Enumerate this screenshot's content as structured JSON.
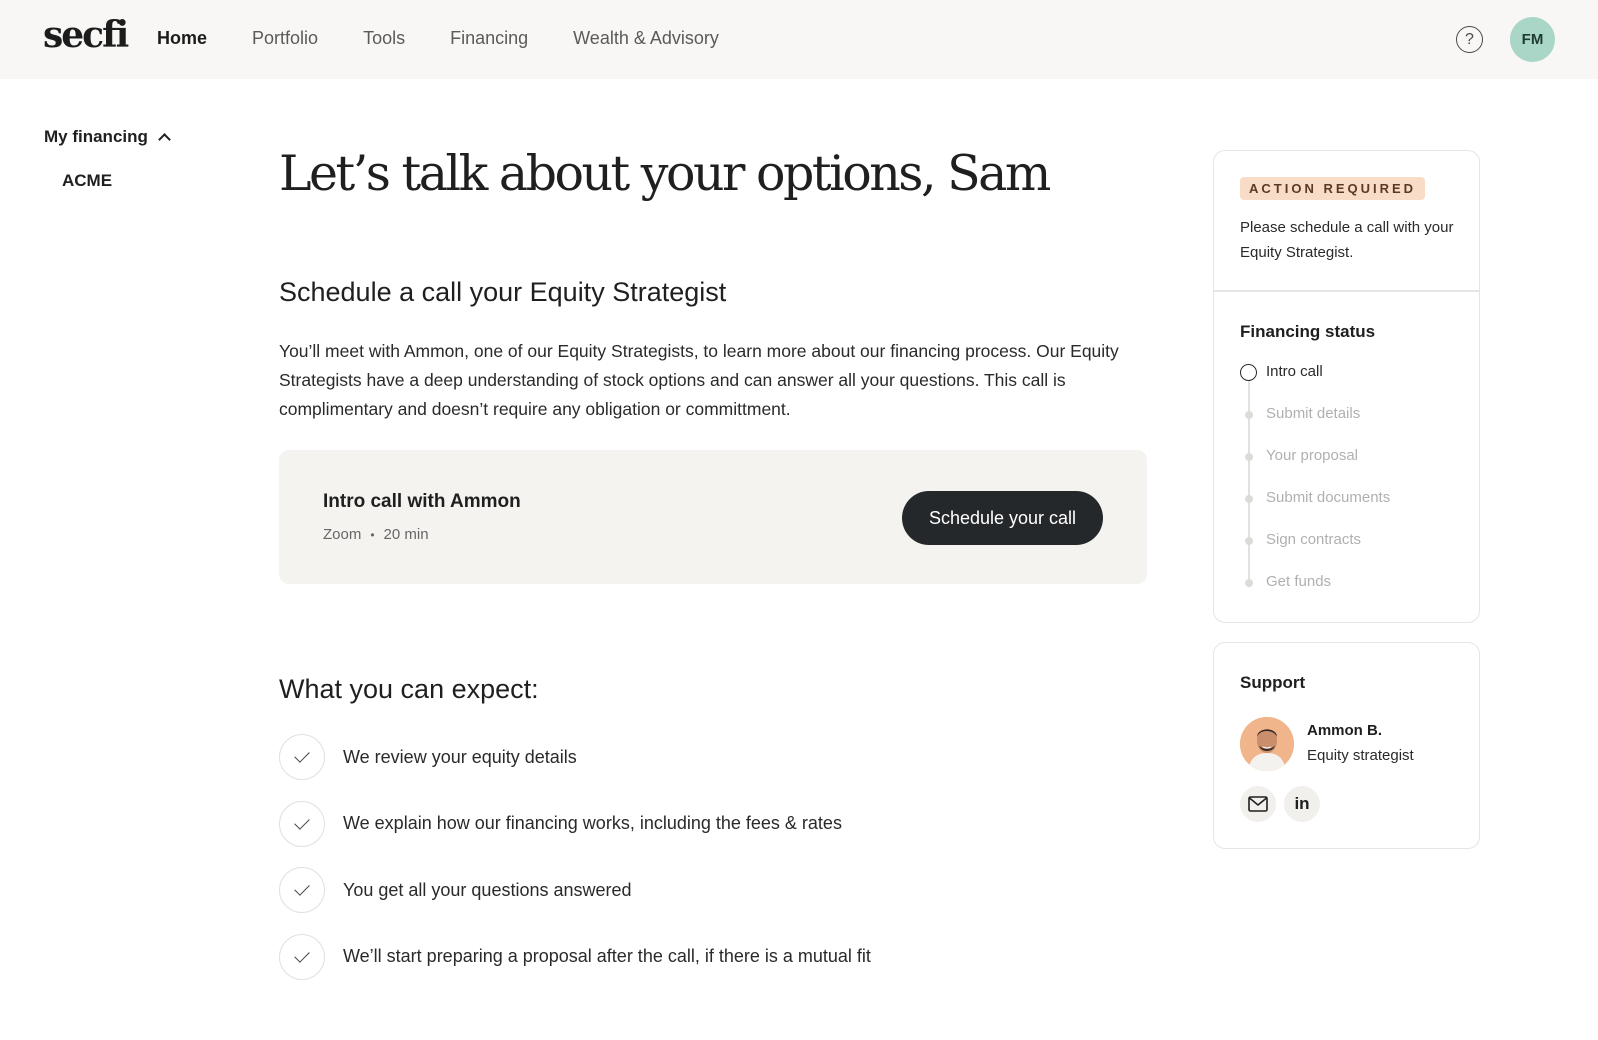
{
  "header": {
    "logo": "secfi",
    "nav": [
      "Home",
      "Portfolio",
      "Tools",
      "Financing",
      "Wealth & Advisory"
    ],
    "help_icon": "question-circle-icon",
    "avatar_initials": "FM",
    "avatar_color": "#a9d6c6"
  },
  "sidebar": {
    "section_label": "My financing",
    "toggle_icon": "chevron-up-icon",
    "items": [
      "ACME"
    ]
  },
  "main": {
    "title": "Let’s talk about your options, Sam",
    "schedule_heading": "Schedule a call your Equity Strategist",
    "intro": "You’ll meet with Ammon, one of our Equity Strategists, to learn more about our financing process. Our Equity Strategists have a deep understanding of stock options and can answer all your questions. This call is complimentary and doesn’t require any obligation or committment.",
    "call_card": {
      "title": "Intro call with Ammon",
      "platform": "Zoom",
      "duration": "20 min",
      "button_label": "Schedule your call"
    },
    "expect_heading": "What you can expect:",
    "expect_items": [
      "We review your equity details",
      "We explain how our financing works, including the fees & rates",
      "You get all your questions answered",
      "We’ll start preparing a proposal after the call, if there is a mutual fit"
    ]
  },
  "status_panel": {
    "badge": "ACTION REQUIRED",
    "badge_color": "#f8dcc7",
    "action_text": "Please schedule a call with your Equity Strategist.",
    "title": "Financing status",
    "steps": [
      {
        "label": "Intro call",
        "state": "current"
      },
      {
        "label": "Submit details",
        "state": "pending"
      },
      {
        "label": "Your proposal",
        "state": "pending"
      },
      {
        "label": "Submit documents",
        "state": "pending"
      },
      {
        "label": "Sign contracts",
        "state": "pending"
      },
      {
        "label": "Get funds",
        "state": "pending"
      }
    ]
  },
  "support": {
    "title": "Support",
    "name": "Ammon B.",
    "role": "Equity strategist",
    "email_icon": "mail-icon",
    "linkedin_label": "in"
  },
  "colors": {
    "primary_button": "#24282b",
    "card_bg": "#f4f3f0",
    "topbar_bg": "#f8f7f5"
  }
}
